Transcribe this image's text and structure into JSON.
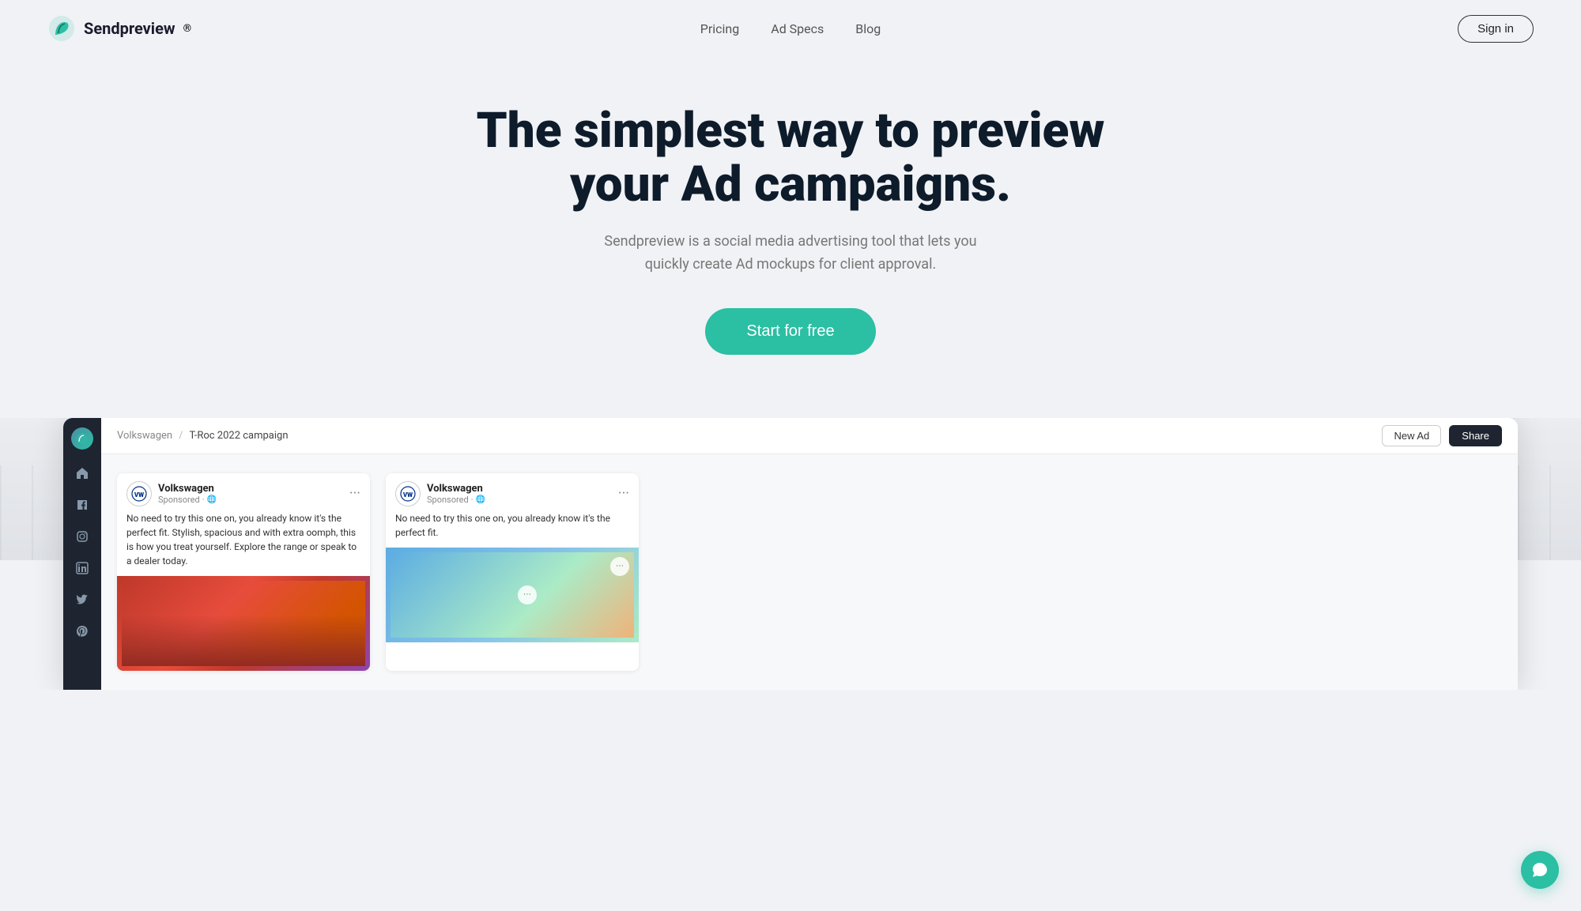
{
  "brand": {
    "logo_alt": "Sendpreview logo",
    "name": "Sendpreview",
    "trademark": "®"
  },
  "navbar": {
    "links": [
      {
        "label": "Pricing",
        "id": "pricing"
      },
      {
        "label": "Ad Specs",
        "id": "ad-specs"
      },
      {
        "label": "Blog",
        "id": "blog"
      }
    ],
    "signin_label": "Sign in"
  },
  "hero": {
    "title": "The simplest way to preview your Ad campaigns.",
    "subtitle": "Sendpreview is a social media advertising tool that lets you quickly create Ad mockups for client approval.",
    "cta_label": "Start for free"
  },
  "app_preview": {
    "breadcrumb": {
      "company": "Volkswagen",
      "separator": "/",
      "campaign": "T-Roc 2022 campaign"
    },
    "topbar_actions": {
      "new_ad": "New Ad",
      "share": "Share"
    },
    "ads": [
      {
        "brand_name": "Volkswagen",
        "sponsored_label": "Sponsored",
        "globe": "🌐",
        "body_text": "No need to try this one on, you already know it's the perfect fit. Stylish, spacious and with extra oomph, this is how you treat yourself. Explore the range or speak to a dealer today.",
        "image_type": "pink-red",
        "menu_dots": "···"
      },
      {
        "brand_name": "Volkswagen",
        "sponsored_label": "Sponsored",
        "globe": "🌐",
        "body_text": "No need to try this one on, you already know it's the perfect fit.",
        "image_type": "blue",
        "menu_dots": "···"
      }
    ],
    "sidebar_icons": [
      "home",
      "facebook",
      "instagram",
      "linkedin",
      "twitter",
      "pinterest"
    ]
  },
  "chat": {
    "icon": "chat"
  }
}
